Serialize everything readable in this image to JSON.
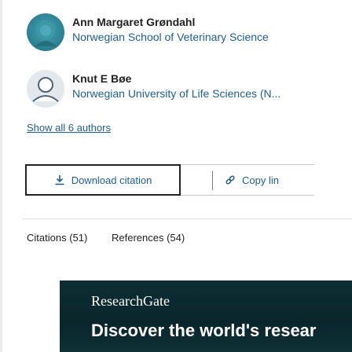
{
  "authors": [
    {
      "name": "Ann Margaret Grøndahl",
      "affiliation": "Norwegian School of Veterinary Science",
      "avatar": "photo"
    },
    {
      "name": "Knut E Bøe",
      "affiliation": "Norwegian University of Life Sciences (N...",
      "avatar": "default-user-icon"
    }
  ],
  "show_authors_label": "Show all 6 authors",
  "actions": {
    "download_label": "Download citation",
    "download_icon": "download-icon",
    "copy_label": "Copy lin",
    "copy_icon": "link-icon"
  },
  "tabs": [
    {
      "label": "Citations (51)"
    },
    {
      "label": "References (54)"
    }
  ],
  "banner": {
    "logo": "ResearchGate",
    "tagline": "Discover the world's resear"
  },
  "colors": {
    "link": "#1e5e8f",
    "banner_bg": "#0b2a2f",
    "avatar_teal": "#2f8798"
  }
}
